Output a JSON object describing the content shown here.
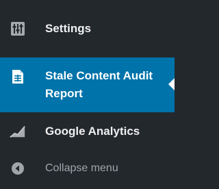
{
  "menu": {
    "items": [
      {
        "label": "Settings",
        "icon": "settings-icon"
      },
      {
        "label": "Stale Content Audit Report",
        "icon": "document-icon",
        "active": true
      },
      {
        "label": "Google Analytics",
        "icon": "analytics-chart-icon"
      },
      {
        "label": "Collapse menu",
        "icon": "collapse-arrow-icon"
      }
    ]
  },
  "colors": {
    "background": "#23282d",
    "active_background": "#0073aa",
    "text": "#f0f0f1",
    "muted_text": "#a0a5aa"
  }
}
